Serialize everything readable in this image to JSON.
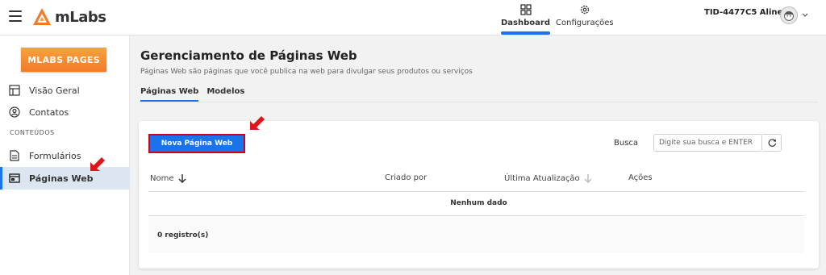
{
  "app": {
    "name": "mLabs"
  },
  "topnav": {
    "dashboard_label": "Dashboard",
    "config_label": "Configurações",
    "user_label": "TID-4477C5 Aline"
  },
  "sidebar": {
    "brand_button": "MLABS PAGES",
    "items": [
      {
        "label": "Visão Geral",
        "icon": "layout-icon"
      },
      {
        "label": "Contatos",
        "icon": "contact-icon"
      }
    ],
    "section_label": "CONTEÚDOS",
    "content_items": [
      {
        "label": "Formulários",
        "icon": "form-icon"
      },
      {
        "label": "Páginas Web",
        "icon": "webpage-icon",
        "active": true
      }
    ]
  },
  "main": {
    "title": "Gerenciamento de Páginas Web",
    "subtitle": "Páginas Web são páginas que você publica na web para divulgar seus produtos ou serviços",
    "tabs": [
      {
        "label": "Páginas Web",
        "active": true
      },
      {
        "label": "Modelos",
        "active": false
      }
    ],
    "new_button": "Nova Página Web",
    "search_label": "Busca",
    "search_placeholder": "Digite sua busca e ENTER",
    "columns": [
      "Nome",
      "Criado por",
      "Última Atualização",
      "Ações"
    ],
    "empty_text": "Nenhum dado",
    "record_count": "0 registro(s)"
  },
  "colors": {
    "accent": "#1a73e8",
    "brand_orange": "#f27b29",
    "highlight_red": "#d0021b"
  }
}
